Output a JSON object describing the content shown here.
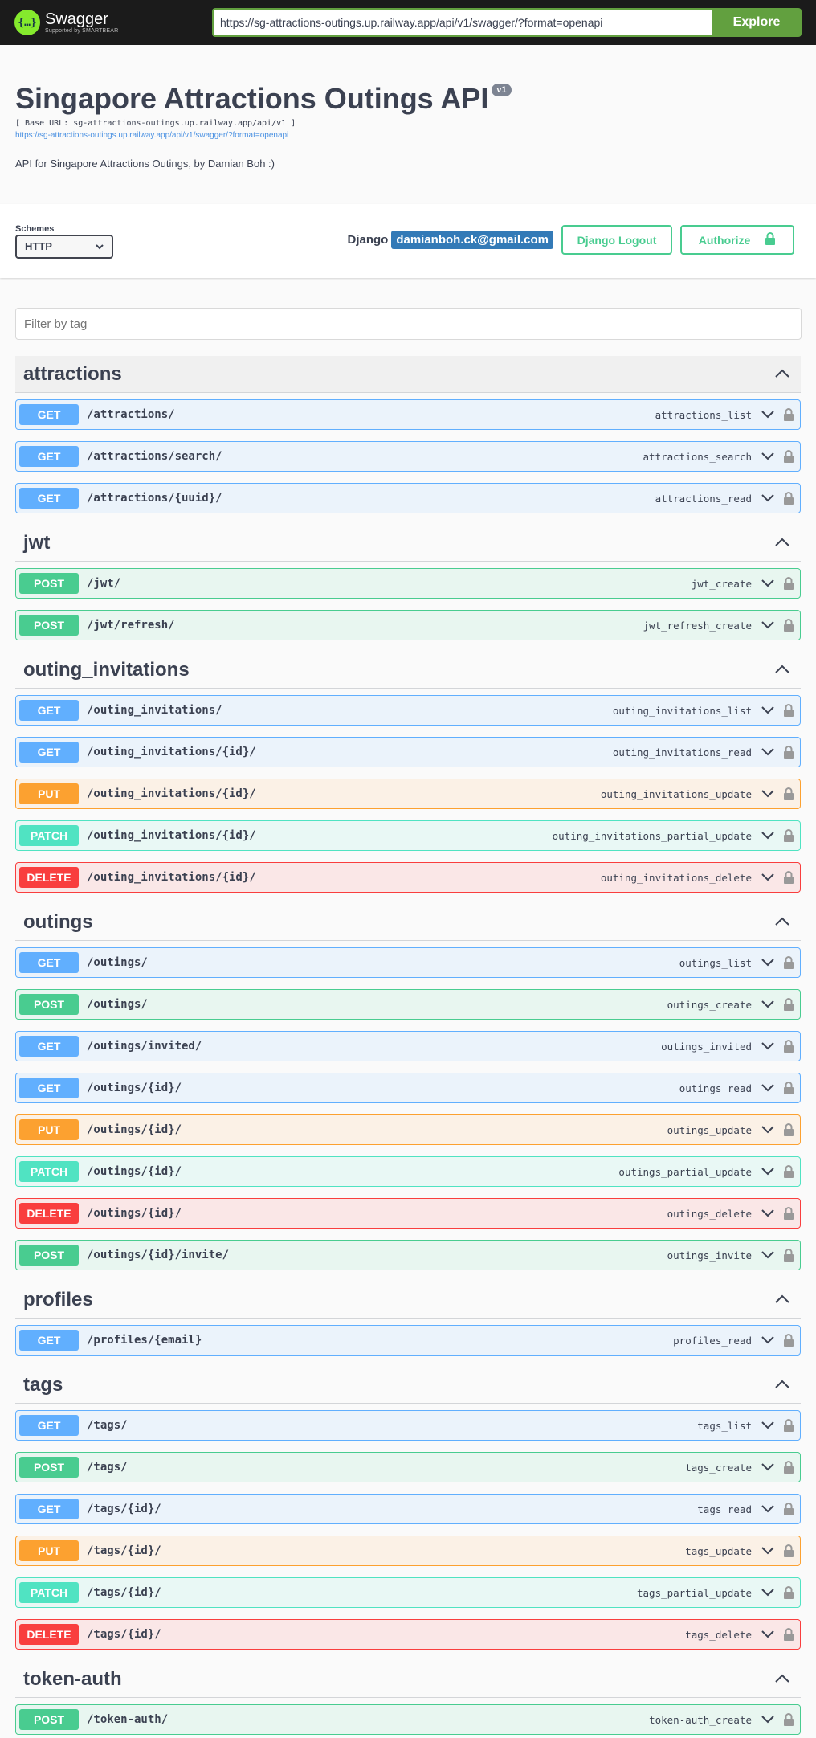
{
  "topbar": {
    "logo_glyph": "{…}",
    "logo_name": "Swagger",
    "logo_sub": "Supported by SMARTBEAR",
    "url_value": "https://sg-attractions-outings.up.railway.app/api/v1/swagger/?format=openapi",
    "explore_label": "Explore",
    "accent": "#62a03f"
  },
  "info": {
    "title": "Singapore Attractions Outings API",
    "version": "v1",
    "base_url": "[ Base URL: sg-attractions-outings.up.railway.app/api/v1 ]",
    "spec_link": "https://sg-attractions-outings.up.railway.app/api/v1/swagger/?format=openapi",
    "description": "API for Singapore Attractions Outings, by Damian Boh :)"
  },
  "schemes": {
    "label": "Schemes",
    "selected": "HTTP"
  },
  "auth": {
    "django_label": "Django",
    "email": "damianboh.ck@gmail.com",
    "logout_label": "Django Logout",
    "authorize_label": "Authorize"
  },
  "filter": {
    "placeholder": "Filter by tag"
  },
  "sections": [
    {
      "name": "attractions",
      "ops": [
        {
          "method": "GET",
          "path": "/attractions/",
          "op_id": "attractions_list"
        },
        {
          "method": "GET",
          "path": "/attractions/search/",
          "op_id": "attractions_search"
        },
        {
          "method": "GET",
          "path": "/attractions/{uuid}/",
          "op_id": "attractions_read"
        }
      ]
    },
    {
      "name": "jwt",
      "ops": [
        {
          "method": "POST",
          "path": "/jwt/",
          "op_id": "jwt_create"
        },
        {
          "method": "POST",
          "path": "/jwt/refresh/",
          "op_id": "jwt_refresh_create"
        }
      ]
    },
    {
      "name": "outing_invitations",
      "ops": [
        {
          "method": "GET",
          "path": "/outing_invitations/",
          "op_id": "outing_invitations_list"
        },
        {
          "method": "GET",
          "path": "/outing_invitations/{id}/",
          "op_id": "outing_invitations_read"
        },
        {
          "method": "PUT",
          "path": "/outing_invitations/{id}/",
          "op_id": "outing_invitations_update"
        },
        {
          "method": "PATCH",
          "path": "/outing_invitations/{id}/",
          "op_id": "outing_invitations_partial_update"
        },
        {
          "method": "DELETE",
          "path": "/outing_invitations/{id}/",
          "op_id": "outing_invitations_delete"
        }
      ]
    },
    {
      "name": "outings",
      "ops": [
        {
          "method": "GET",
          "path": "/outings/",
          "op_id": "outings_list"
        },
        {
          "method": "POST",
          "path": "/outings/",
          "op_id": "outings_create"
        },
        {
          "method": "GET",
          "path": "/outings/invited/",
          "op_id": "outings_invited"
        },
        {
          "method": "GET",
          "path": "/outings/{id}/",
          "op_id": "outings_read"
        },
        {
          "method": "PUT",
          "path": "/outings/{id}/",
          "op_id": "outings_update"
        },
        {
          "method": "PATCH",
          "path": "/outings/{id}/",
          "op_id": "outings_partial_update"
        },
        {
          "method": "DELETE",
          "path": "/outings/{id}/",
          "op_id": "outings_delete"
        },
        {
          "method": "POST",
          "path": "/outings/{id}/invite/",
          "op_id": "outings_invite"
        }
      ]
    },
    {
      "name": "profiles",
      "ops": [
        {
          "method": "GET",
          "path": "/profiles/{email}",
          "op_id": "profiles_read"
        }
      ]
    },
    {
      "name": "tags",
      "ops": [
        {
          "method": "GET",
          "path": "/tags/",
          "op_id": "tags_list"
        },
        {
          "method": "POST",
          "path": "/tags/",
          "op_id": "tags_create"
        },
        {
          "method": "GET",
          "path": "/tags/{id}/",
          "op_id": "tags_read"
        },
        {
          "method": "PUT",
          "path": "/tags/{id}/",
          "op_id": "tags_update"
        },
        {
          "method": "PATCH",
          "path": "/tags/{id}/",
          "op_id": "tags_partial_update"
        },
        {
          "method": "DELETE",
          "path": "/tags/{id}/",
          "op_id": "tags_delete"
        }
      ]
    },
    {
      "name": "token-auth",
      "ops": [
        {
          "method": "POST",
          "path": "/token-auth/",
          "op_id": "token-auth_create"
        }
      ]
    }
  ],
  "colors": {
    "get": "#61affe",
    "post": "#49cc90",
    "put": "#fca130",
    "patch": "#50e3c2",
    "delete": "#f93e3e"
  }
}
